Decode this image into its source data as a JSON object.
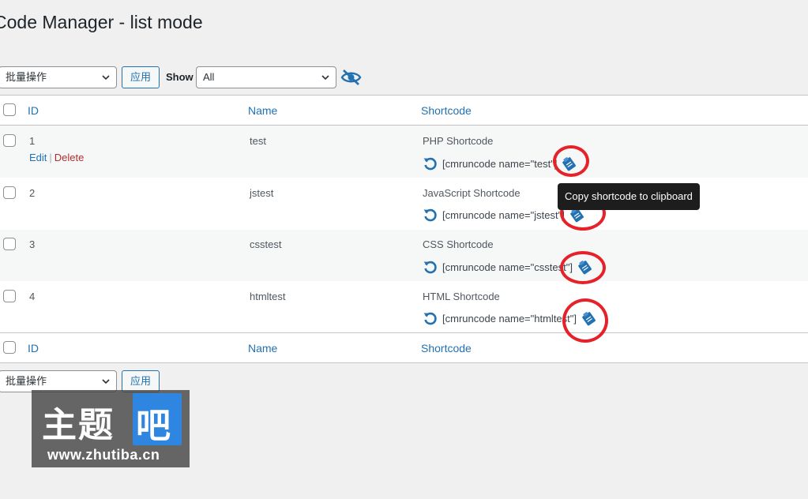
{
  "page": {
    "title": "Code Manager - list mode"
  },
  "toolbar": {
    "bulk_action": "批量操作",
    "apply_label": "应用",
    "show_label": "Show",
    "show_filter": "All"
  },
  "table": {
    "columns": {
      "id": "ID",
      "name": "Name",
      "shortcode": "Shortcode"
    },
    "rows": [
      {
        "id": "1",
        "name": "test",
        "type": "PHP Shortcode",
        "code": "[cmruncode name=\"test\"]"
      },
      {
        "id": "2",
        "name": "jstest",
        "type": "JavaScript Shortcode",
        "code": "[cmruncode name=\"jstest\"]"
      },
      {
        "id": "3",
        "name": "csstest",
        "type": "CSS Shortcode",
        "code": "[cmruncode name=\"csstest\"]"
      },
      {
        "id": "4",
        "name": "htmltest",
        "type": "HTML Shortcode",
        "code": "[cmruncode name=\"htmltest\"]"
      }
    ],
    "row_actions": {
      "edit": "Edit",
      "separator": "|",
      "delete": "Delete"
    }
  },
  "tooltip": {
    "text": "Copy shortcode to clipboard"
  },
  "bottom_toolbar": {
    "bulk_action": "批量操作",
    "apply_label": "应用"
  },
  "watermark": {
    "brand": "主题",
    "badge": "吧",
    "url": "www.zhutiba.cn"
  },
  "colors": {
    "link": "#2271b1",
    "delete": "#b32d2e",
    "annotation_ring": "#e52229",
    "tooltip_bg": "#1d1d1d"
  },
  "icons": [
    "chevron-down-icon",
    "hide-eye-icon",
    "reload-icon",
    "copy-clipboard-icon"
  ]
}
